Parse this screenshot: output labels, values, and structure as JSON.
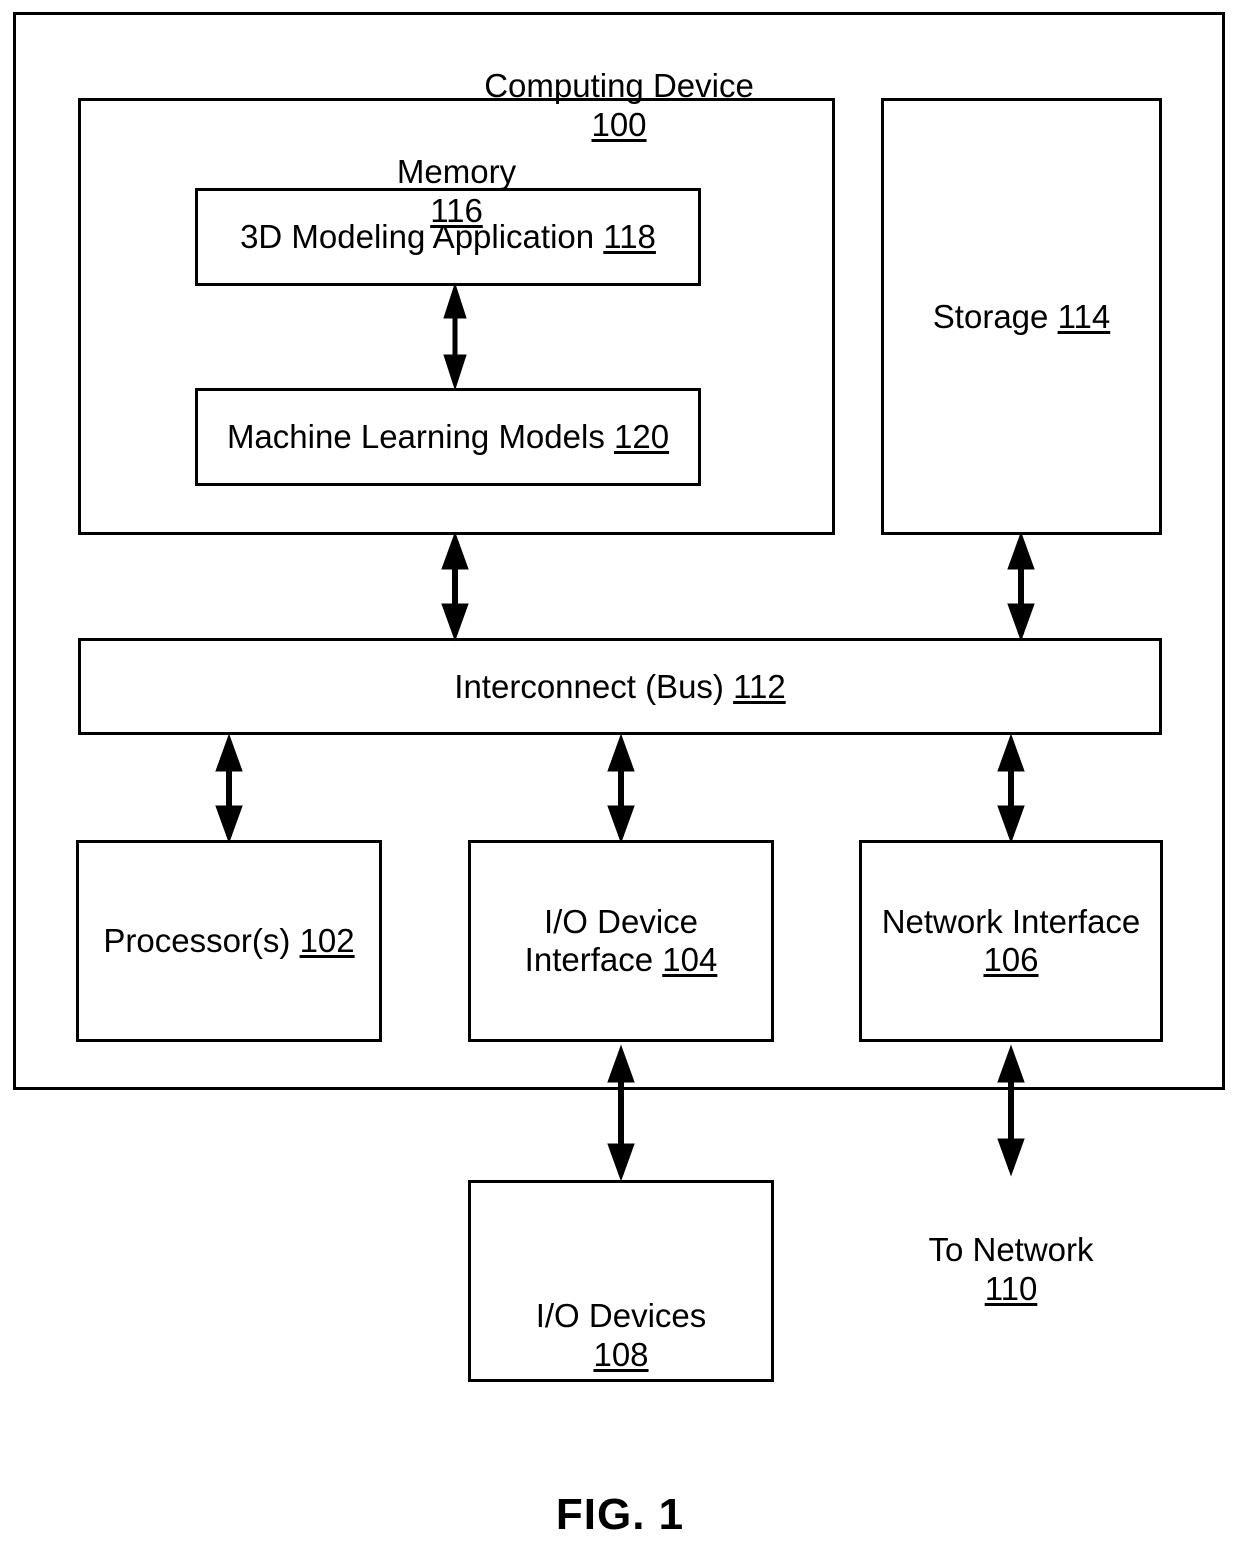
{
  "figure": {
    "caption": "FIG. 1",
    "title_text": "Computing Device",
    "title_ref": "100"
  },
  "blocks": {
    "computing_device": {
      "text": "Computing Device",
      "ref": "100"
    },
    "memory": {
      "text": "Memory",
      "ref": "116"
    },
    "modeling_app": {
      "text": "3D Modeling Application",
      "ref": "118"
    },
    "ml_models": {
      "text": "Machine Learning Models",
      "ref": "120"
    },
    "storage": {
      "text": "Storage",
      "ref": "114"
    },
    "interconnect": {
      "text": "Interconnect (Bus)",
      "ref": "112"
    },
    "processors": {
      "text": "Processor(s)",
      "ref": "102"
    },
    "io_device_interface": {
      "line1": "I/O Device",
      "line2": "Interface",
      "ref": "104"
    },
    "network_interface": {
      "line1": "Network Interface",
      "ref": "106"
    },
    "io_devices": {
      "text": "I/O Devices",
      "ref": "108"
    },
    "to_network": {
      "text": "To Network",
      "ref": "110"
    }
  },
  "colors": {
    "line": "#000000",
    "background": "#ffffff"
  }
}
